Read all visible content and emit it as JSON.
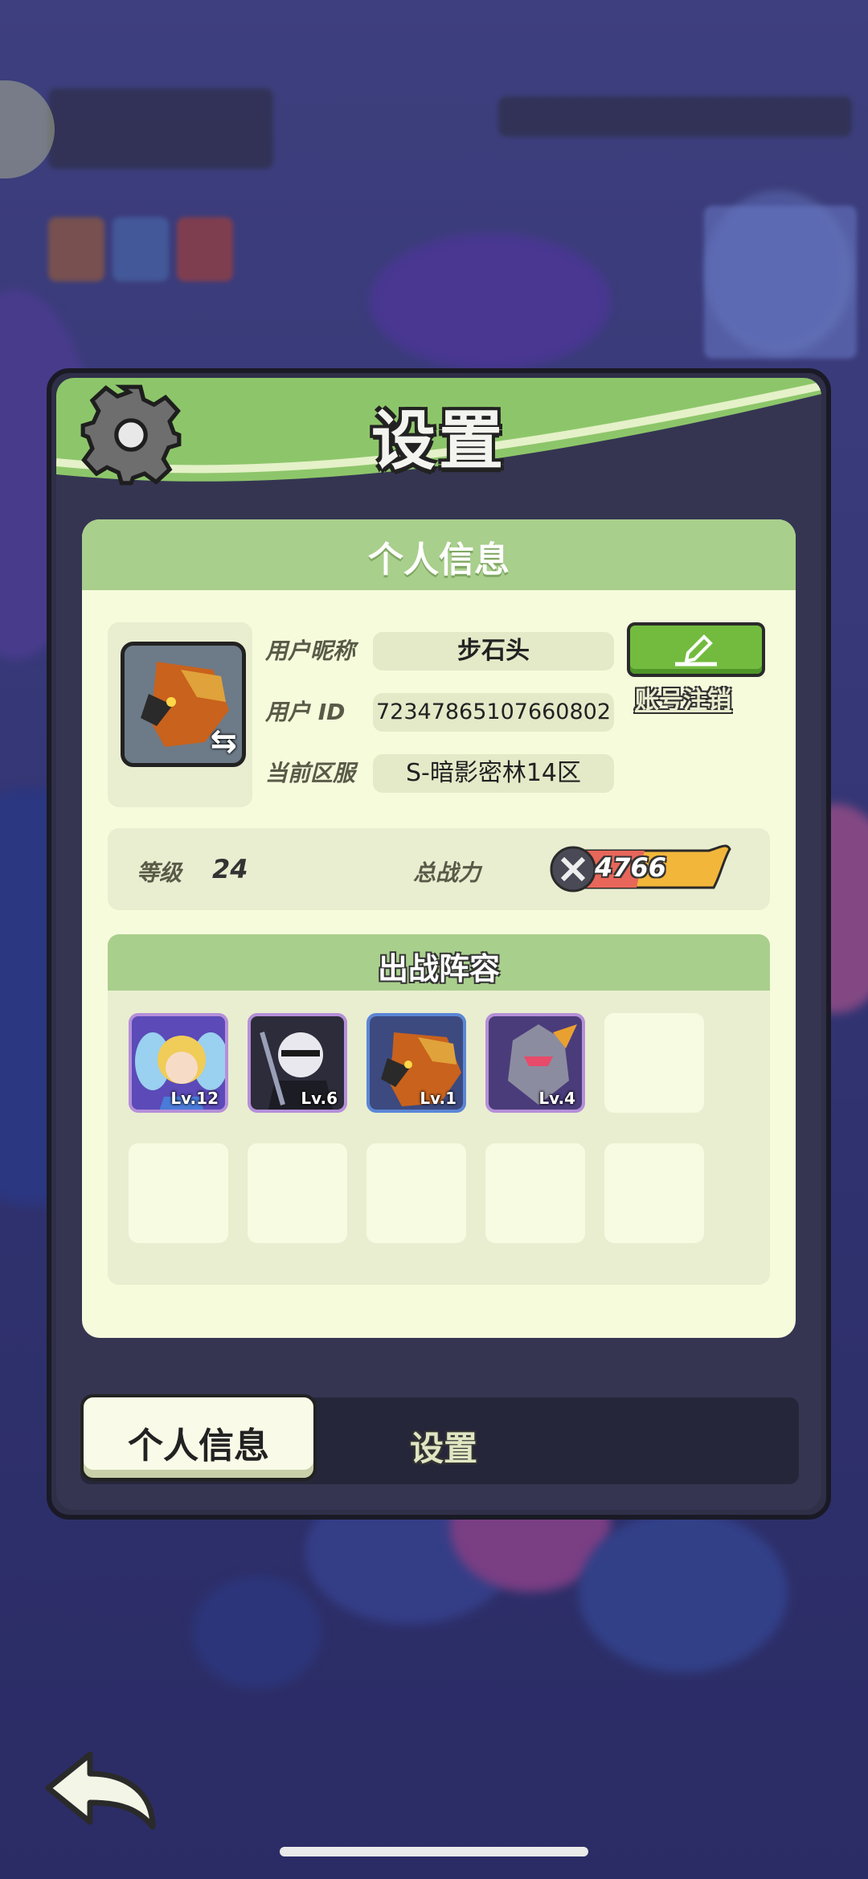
{
  "dialog": {
    "title": "设置"
  },
  "panel": {
    "title": "个人信息"
  },
  "profile": {
    "nickname_label": "用户昵称",
    "nickname": "步石头",
    "id_label": "用户 ID",
    "id": "72347865107660802",
    "cancel_account": "账号注销",
    "server_label": "当前区服",
    "server": "S-暗影密林14区"
  },
  "stats": {
    "level_label": "等级",
    "level": "24",
    "power_label": "总战力",
    "power": "4766"
  },
  "lineup": {
    "title": "出战阵容",
    "heroes": [
      {
        "level": "Lv.12"
      },
      {
        "level": "Lv.6"
      },
      {
        "level": "Lv.1"
      },
      {
        "level": "Lv.4"
      }
    ]
  },
  "tabs": {
    "info": "个人信息",
    "settings": "设置"
  },
  "colors": {
    "header_green": "#8dc66a",
    "panel_bg": "#f6fbdc",
    "button_green": "#72bb3f"
  },
  "icons": [
    "gear-icon",
    "swap-icon",
    "pencil-icon",
    "sword-icon",
    "back-arrow-icon"
  ]
}
